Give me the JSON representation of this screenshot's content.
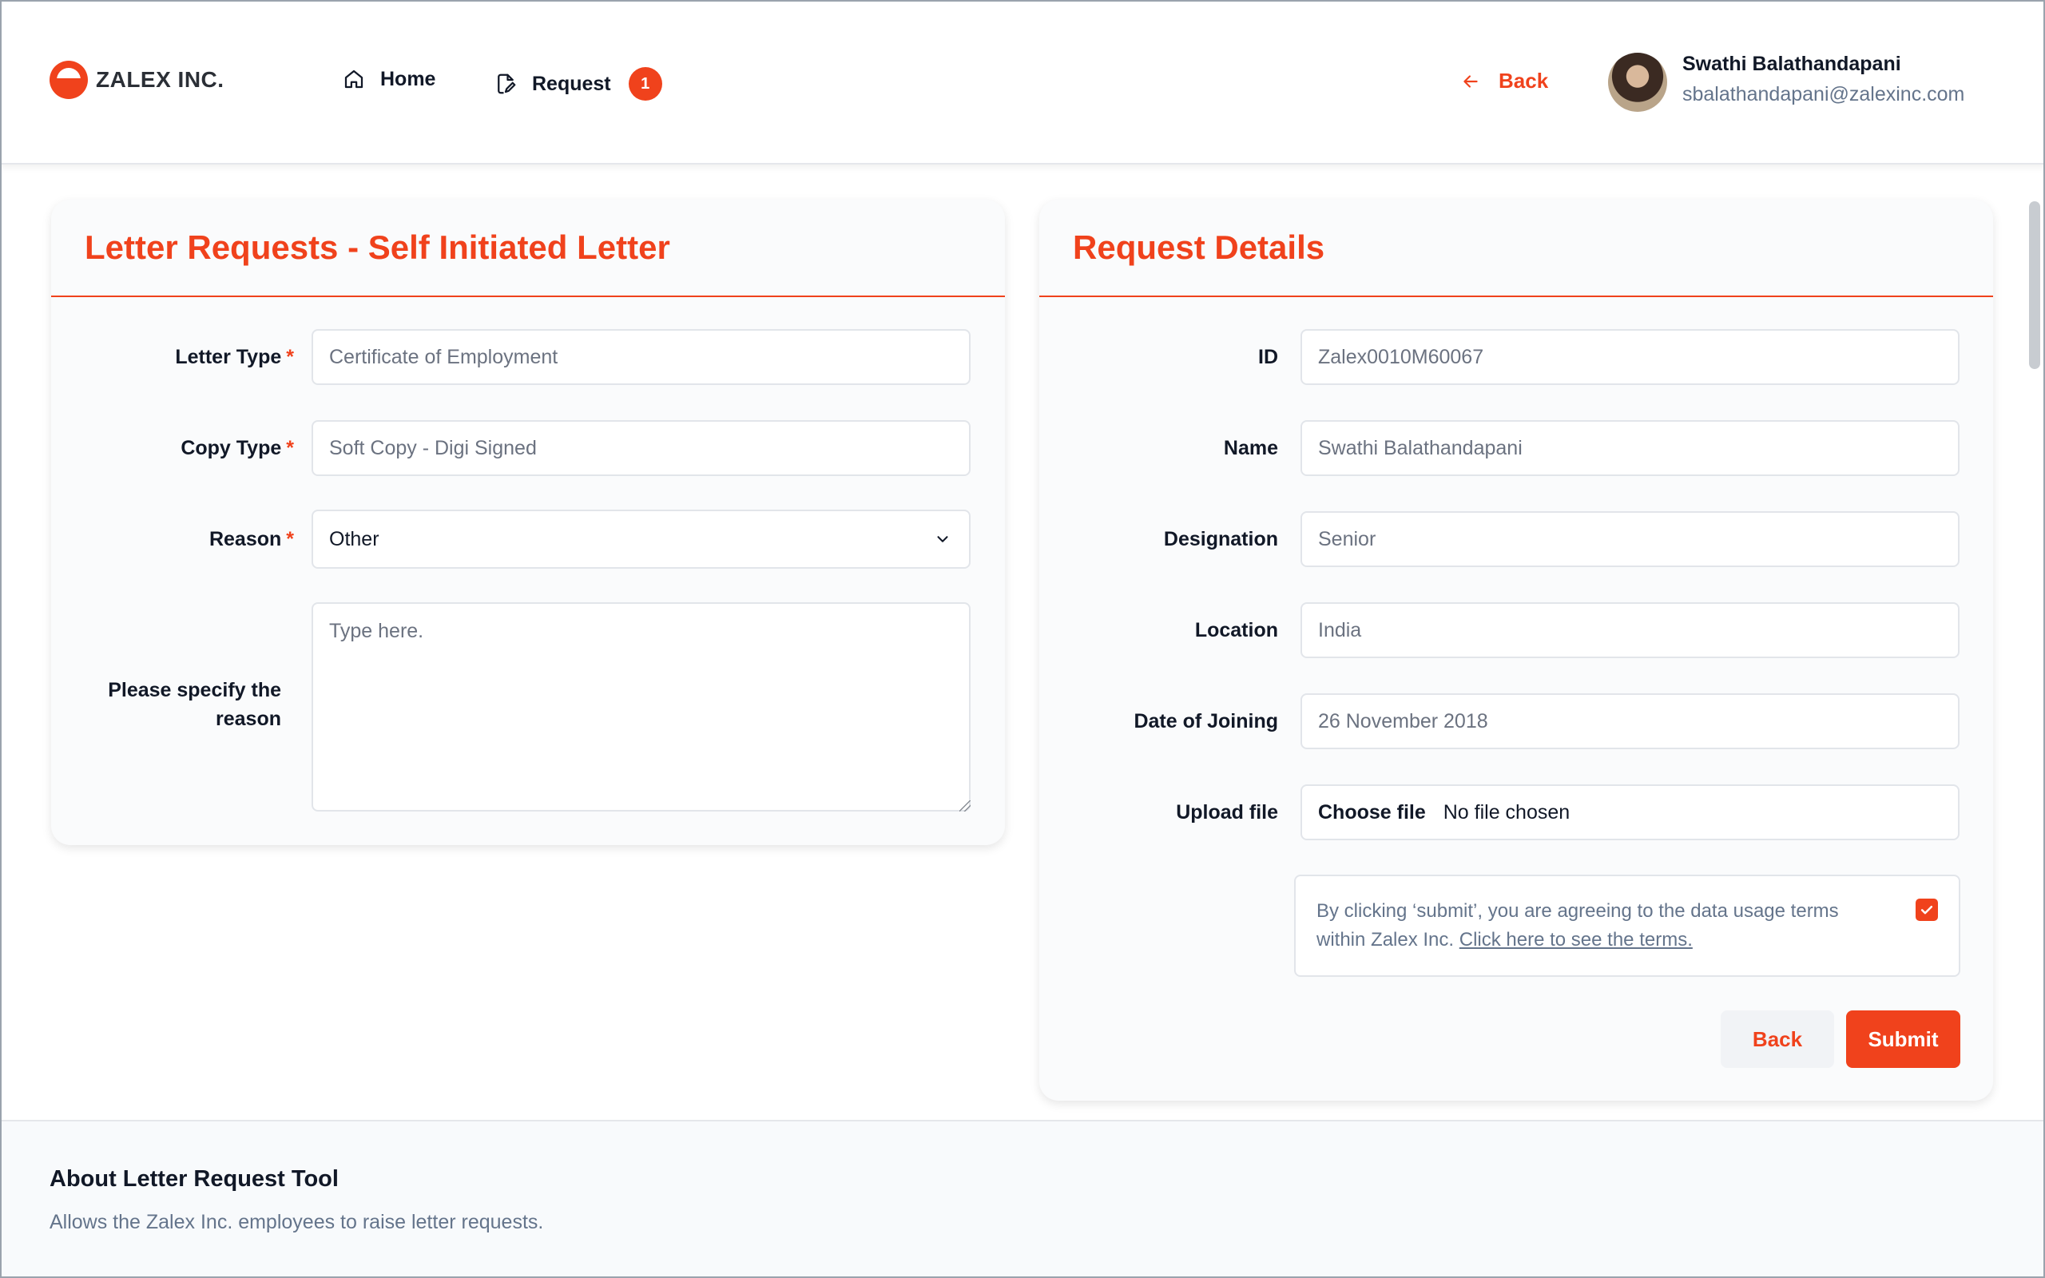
{
  "brand": {
    "name": "ZALEX INC.",
    "accent": "#f0421c"
  },
  "nav": {
    "home_label": "Home",
    "request_label": "Request",
    "request_badge": "1"
  },
  "header": {
    "back_label": "Back",
    "user_name": "Swathi Balathandapani",
    "user_email": "sbalathandapani@zalexinc.com"
  },
  "letter_card": {
    "title": "Letter Requests - Self Initiated Letter",
    "letter_type_label": "Letter Type",
    "letter_type_value": "Certificate of Employment",
    "copy_type_label": "Copy Type",
    "copy_type_value": "Soft Copy - Digi Signed",
    "reason_label": "Reason",
    "reason_value": "Other",
    "specify_label": "Please specify the reason",
    "specify_placeholder": "Type here.",
    "required_mark": "*"
  },
  "details_card": {
    "title": "Request Details",
    "id_label": "ID",
    "id_value": "Zalex0010M60067",
    "name_label": "Name",
    "name_value": "Swathi Balathandapani",
    "designation_label": "Designation",
    "designation_value": "Senior",
    "location_label": "Location",
    "location_value": "India",
    "doj_label": "Date of Joining",
    "doj_value": "26 November 2018",
    "upload_label": "Upload file",
    "choose_file_label": "Choose file",
    "no_file_label": "No file chosen",
    "terms_text": "By clicking ‘submit’, you are agreeing to the data usage terms within Zalex Inc.",
    "terms_link": "Click here to see the terms.",
    "terms_checked": true,
    "back_button": "Back",
    "submit_button": "Submit"
  },
  "footer": {
    "title": "About Letter Request Tool",
    "description": "Allows the Zalex Inc. employees to raise letter requests."
  }
}
